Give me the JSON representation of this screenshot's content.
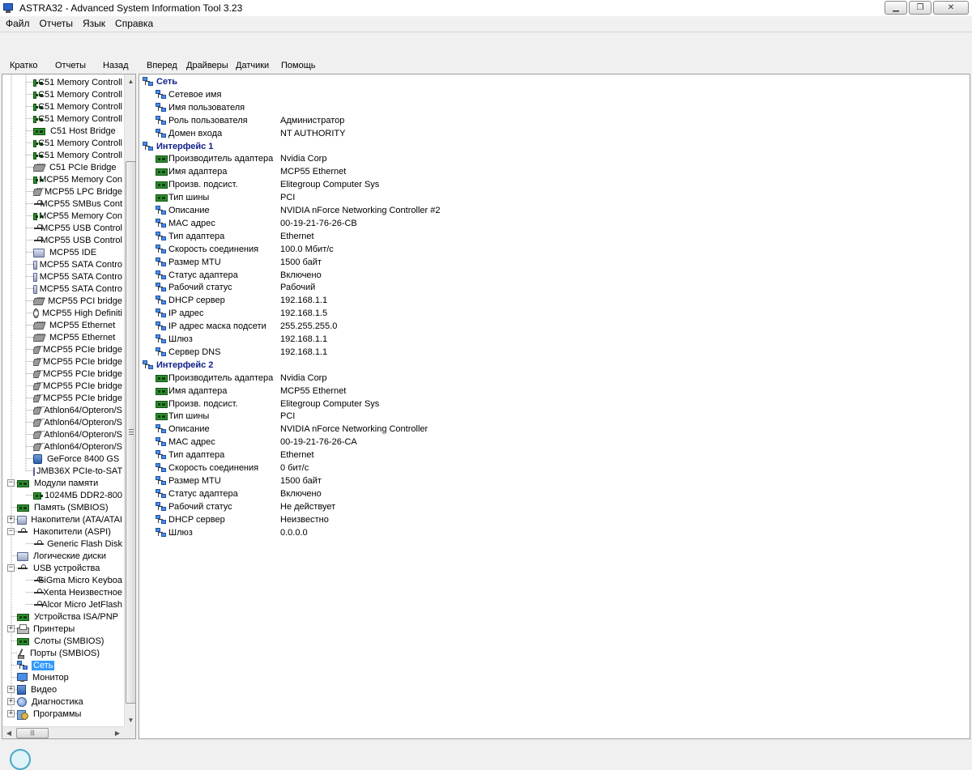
{
  "window": {
    "title": "ASTRA32 - Advanced System Information Tool 3.23"
  },
  "menu": [
    "Файл",
    "Отчеты",
    "Язык",
    "Справка"
  ],
  "toolbar": [
    "Кратко",
    "Отчеты",
    "Назад",
    "Вперед",
    "Драйверы",
    "Датчики",
    "Помощь"
  ],
  "tree": [
    {
      "label": "C51 Memory Controll",
      "icon": "card-icon",
      "level": 2
    },
    {
      "label": "C51 Memory Controll",
      "icon": "card-icon",
      "level": 2
    },
    {
      "label": "C51 Memory Controll",
      "icon": "card-icon",
      "level": 2
    },
    {
      "label": "C51 Memory Controll",
      "icon": "card-icon",
      "level": 2
    },
    {
      "label": "C51 Host Bridge",
      "icon": "card-icon",
      "level": 2
    },
    {
      "label": "C51 Memory Controll",
      "icon": "card-icon",
      "level": 2
    },
    {
      "label": "C51 Memory Controll",
      "icon": "card-icon",
      "level": 2
    },
    {
      "label": "C51 PCIe Bridge",
      "icon": "chip-icon",
      "level": 2
    },
    {
      "label": "MCP55 Memory Con",
      "icon": "card-icon",
      "level": 2
    },
    {
      "label": "MCP55 LPC Bridge",
      "icon": "chip-icon",
      "level": 2
    },
    {
      "label": "MCP55 SMBus Cont",
      "icon": "usb-icon",
      "level": 2
    },
    {
      "label": "MCP55 Memory Con",
      "icon": "card-icon",
      "level": 2
    },
    {
      "label": "MCP55 USB Control",
      "icon": "usb-icon",
      "level": 2
    },
    {
      "label": "MCP55 USB Control",
      "icon": "usb-icon",
      "level": 2
    },
    {
      "label": "MCP55 IDE",
      "icon": "disk-icon",
      "level": 2
    },
    {
      "label": "MCP55 SATA Contro",
      "icon": "disk-icon",
      "level": 2
    },
    {
      "label": "MCP55 SATA Contro",
      "icon": "disk-icon",
      "level": 2
    },
    {
      "label": "MCP55 SATA Contro",
      "icon": "disk-icon",
      "level": 2
    },
    {
      "label": "MCP55 PCI bridge",
      "icon": "chip-icon",
      "level": 2
    },
    {
      "label": "MCP55 High Definiti",
      "icon": "cd-icon",
      "level": 2
    },
    {
      "label": "MCP55 Ethernet",
      "icon": "chip-icon",
      "level": 2
    },
    {
      "label": "MCP55 Ethernet",
      "icon": "chip-icon",
      "level": 2
    },
    {
      "label": "MCP55 PCIe bridge",
      "icon": "chip-icon",
      "level": 2
    },
    {
      "label": "MCP55 PCIe bridge",
      "icon": "chip-icon",
      "level": 2
    },
    {
      "label": "MCP55 PCIe bridge",
      "icon": "chip-icon",
      "level": 2
    },
    {
      "label": "MCP55 PCIe bridge",
      "icon": "chip-icon",
      "level": 2
    },
    {
      "label": "MCP55 PCIe bridge",
      "icon": "chip-icon",
      "level": 2
    },
    {
      "label": "Athlon64/Opteron/S",
      "icon": "chip-icon",
      "level": 2
    },
    {
      "label": "Athlon64/Opteron/S",
      "icon": "chip-icon",
      "level": 2
    },
    {
      "label": "Athlon64/Opteron/S",
      "icon": "chip-icon",
      "level": 2
    },
    {
      "label": "Athlon64/Opteron/S",
      "icon": "chip-icon",
      "level": 2
    },
    {
      "label": "GeForce 8400 GS",
      "icon": "gpu-icon",
      "level": 2
    },
    {
      "label": "JMB36X PCIe-to-SAT",
      "icon": "disk-icon",
      "level": 2
    },
    {
      "label": "Модули памяти",
      "icon": "card-icon",
      "level": 1,
      "expander": "−"
    },
    {
      "label": "1024МБ DDR2-800",
      "icon": "card-icon",
      "level": 2
    },
    {
      "label": "Память (SMBIOS)",
      "icon": "card-icon",
      "level": 1
    },
    {
      "label": "Накопители (ATA/ATAI",
      "icon": "disk-icon",
      "level": 1,
      "expander": "+"
    },
    {
      "label": "Накопители (ASPI)",
      "icon": "usb-icon",
      "level": 1,
      "expander": "−"
    },
    {
      "label": "Generic Flash Disk",
      "icon": "usb-icon",
      "level": 2
    },
    {
      "label": "Логические диски",
      "icon": "disk-icon",
      "level": 1
    },
    {
      "label": "USB устройства",
      "icon": "usb-icon",
      "level": 1,
      "expander": "−"
    },
    {
      "label": "SiGma Micro Keyboa",
      "icon": "usb-icon",
      "level": 2
    },
    {
      "label": "Xenta Неизвестное",
      "icon": "usb-icon",
      "level": 2
    },
    {
      "label": "Alcor Micro JetFlash",
      "icon": "usb-icon",
      "level": 2
    },
    {
      "label": "Устройства ISA/PNP",
      "icon": "card-icon",
      "level": 1
    },
    {
      "label": "Принтеры",
      "icon": "printer-icon",
      "level": 1,
      "expander": "+"
    },
    {
      "label": "Слоты (SMBIOS)",
      "icon": "card-icon",
      "level": 1
    },
    {
      "label": "Порты (SMBIOS)",
      "icon": "port-icon",
      "level": 1
    },
    {
      "label": "Сеть",
      "icon": "network-icon",
      "level": 1,
      "selected": true
    },
    {
      "label": "Монитор",
      "icon": "monitor-icon",
      "level": 1
    },
    {
      "label": "Видео",
      "icon": "video-icon",
      "level": 1,
      "expander": "+"
    },
    {
      "label": "Диагностика",
      "icon": "diagnostics-icon",
      "level": 1,
      "expander": "+"
    },
    {
      "label": "Программы",
      "icon": "programs-icon",
      "level": 1,
      "expander": "+"
    }
  ],
  "details": [
    {
      "section": true,
      "prop": "Сеть",
      "icon": "network-icon"
    },
    {
      "prop": "Сетевое имя",
      "val": "",
      "icon": "network-icon"
    },
    {
      "prop": "Имя пользователя",
      "val": "",
      "icon": "network-icon"
    },
    {
      "prop": "Роль пользователя",
      "val": "Администратор",
      "icon": "network-icon"
    },
    {
      "prop": "Домен входа",
      "val": "NT AUTHORITY",
      "icon": "network-icon"
    },
    {
      "section": true,
      "prop": "Интерфейс 1",
      "icon": "network-icon"
    },
    {
      "prop": "Производитель адаптера",
      "val": "Nvidia Corp",
      "icon": "card-icon"
    },
    {
      "prop": "Имя адаптера",
      "val": "MCP55 Ethernet",
      "icon": "card-icon"
    },
    {
      "prop": "Произв. подсист.",
      "val": "Elitegroup Computer Sys",
      "icon": "card-icon"
    },
    {
      "prop": "Тип шины",
      "val": "PCI",
      "icon": "card-icon"
    },
    {
      "prop": "Описание",
      "val": "NVIDIA nForce Networking Controller #2",
      "icon": "network-icon"
    },
    {
      "prop": "MAC адрес",
      "val": "00-19-21-76-26-CB",
      "icon": "network-icon"
    },
    {
      "prop": "Тип адаптера",
      "val": "Ethernet",
      "icon": "network-icon"
    },
    {
      "prop": "Скорость соединения",
      "val": "100.0 Мбит/с",
      "icon": "network-icon"
    },
    {
      "prop": "Размер MTU",
      "val": "1500 байт",
      "icon": "network-icon"
    },
    {
      "prop": "Статус адаптера",
      "val": "Включено",
      "icon": "network-icon"
    },
    {
      "prop": "Рабочий статус",
      "val": "Рабочий",
      "icon": "network-icon"
    },
    {
      "prop": "DHCP сервер",
      "val": "192.168.1.1",
      "icon": "network-icon"
    },
    {
      "prop": "IP адрес",
      "val": "192.168.1.5",
      "icon": "network-icon"
    },
    {
      "prop": "IP адрес маска подсети",
      "val": "255.255.255.0",
      "icon": "network-icon"
    },
    {
      "prop": "Шлюз",
      "val": "192.168.1.1",
      "icon": "network-icon"
    },
    {
      "prop": "Сервер DNS",
      "val": "192.168.1.1",
      "icon": "network-icon"
    },
    {
      "section": true,
      "prop": "Интерфейс 2",
      "icon": "network-icon"
    },
    {
      "prop": "Производитель адаптера",
      "val": "Nvidia Corp",
      "icon": "card-icon"
    },
    {
      "prop": "Имя адаптера",
      "val": "MCP55 Ethernet",
      "icon": "card-icon"
    },
    {
      "prop": "Произв. подсист.",
      "val": "Elitegroup Computer Sys",
      "icon": "card-icon"
    },
    {
      "prop": "Тип шины",
      "val": "PCI",
      "icon": "card-icon"
    },
    {
      "prop": "Описание",
      "val": "NVIDIA nForce Networking Controller",
      "icon": "network-icon"
    },
    {
      "prop": "MAC адрес",
      "val": "00-19-21-76-26-CA",
      "icon": "network-icon"
    },
    {
      "prop": "Тип адаптера",
      "val": "Ethernet",
      "icon": "network-icon"
    },
    {
      "prop": "Скорость соединения",
      "val": "0 бит/с",
      "icon": "network-icon"
    },
    {
      "prop": "Размер MTU",
      "val": "1500 байт",
      "icon": "network-icon"
    },
    {
      "prop": "Статус адаптера",
      "val": "Включено",
      "icon": "network-icon"
    },
    {
      "prop": "Рабочий статус",
      "val": "Не действует",
      "icon": "network-icon"
    },
    {
      "prop": "DHCP сервер",
      "val": "Неизвестно",
      "icon": "network-icon"
    },
    {
      "prop": "Шлюз",
      "val": "0.0.0.0",
      "icon": "network-icon"
    }
  ]
}
